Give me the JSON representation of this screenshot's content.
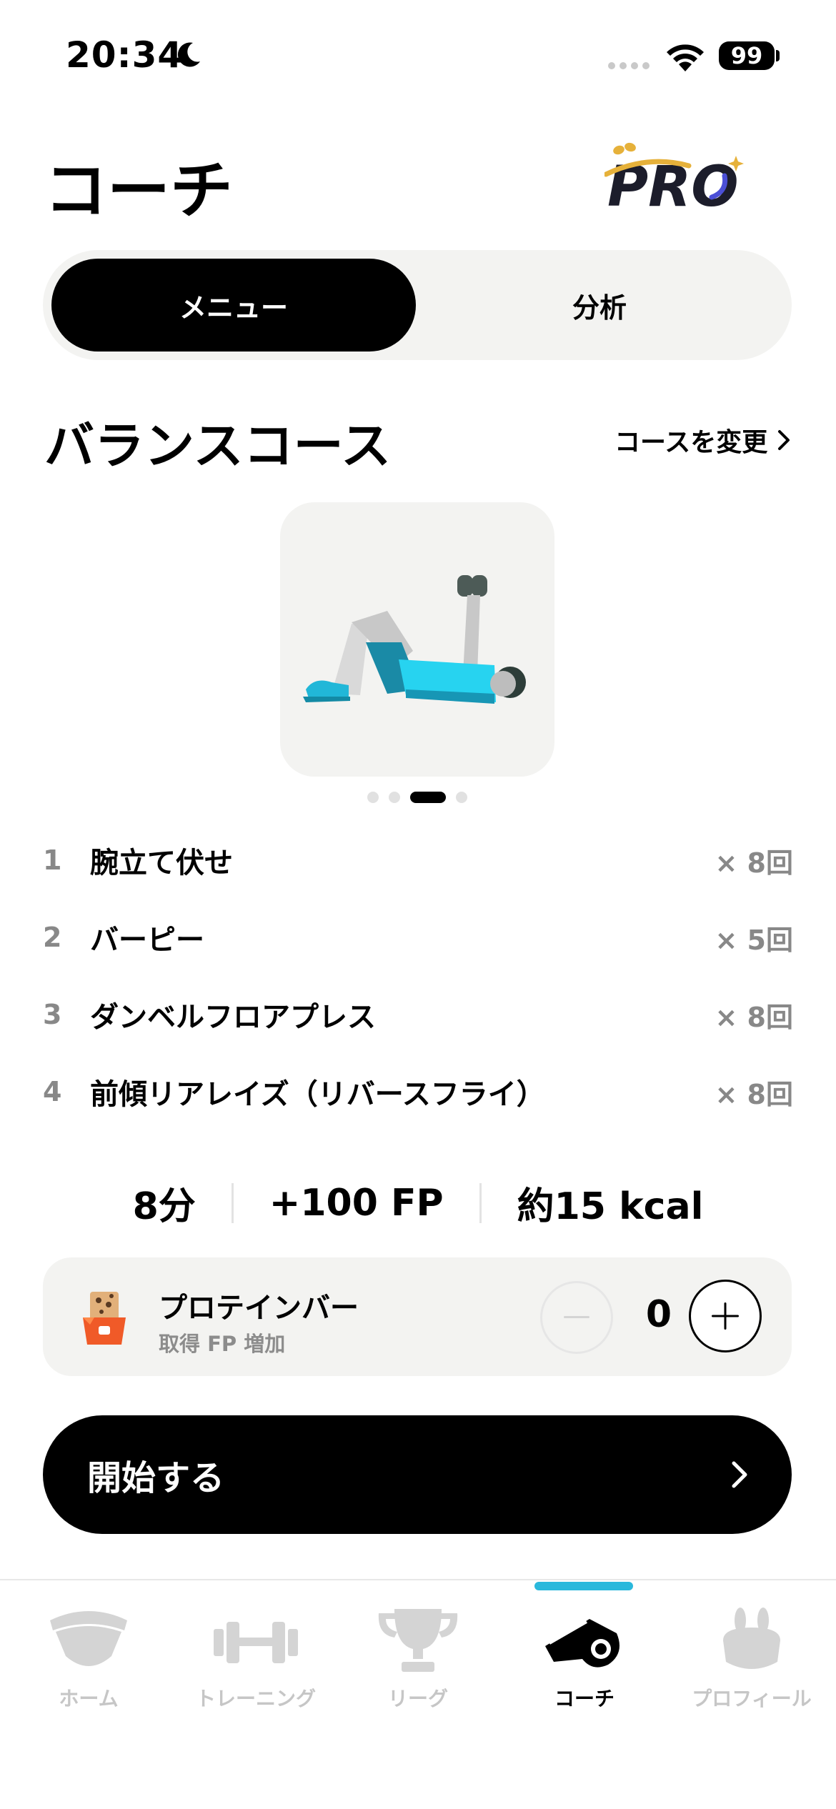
{
  "status_bar": {
    "time": "20:34",
    "battery": "99"
  },
  "header": {
    "title": "コーチ",
    "pro_badge": "PRO"
  },
  "segments": {
    "menu_label": "メニュー",
    "analysis_label": "分析",
    "active": "menu"
  },
  "course": {
    "title": "バランスコース",
    "change_label": "コースを変更",
    "carousel_total": 4,
    "carousel_active": 3
  },
  "exercises": [
    {
      "num": "1",
      "name": "腕立て伏せ",
      "reps": "× 8回"
    },
    {
      "num": "2",
      "name": "バーピー",
      "reps": "× 5回"
    },
    {
      "num": "3",
      "name": "ダンベルフロアプレス",
      "reps": "× 8回"
    },
    {
      "num": "4",
      "name": "前傾リアレイズ（リバースフライ）",
      "reps": "× 8回"
    }
  ],
  "stats": {
    "duration": "8分",
    "fp": "+100 FP",
    "calories": "約15 kcal"
  },
  "protein": {
    "name": "プロテインバー",
    "subtitle": "取得 FP 増加",
    "count": "0"
  },
  "start_button": {
    "label": "開始する"
  },
  "tabs": [
    {
      "label": "ホーム",
      "icon": "home-icon",
      "active": false
    },
    {
      "label": "トレーニング",
      "icon": "dumbbell-icon",
      "active": false
    },
    {
      "label": "リーグ",
      "icon": "trophy-icon",
      "active": false
    },
    {
      "label": "コーチ",
      "icon": "whistle-icon",
      "active": true
    },
    {
      "label": "プロフィール",
      "icon": "rabbit-icon",
      "active": false
    }
  ],
  "colors": {
    "accent_cyan": "#2ab8dc",
    "pro_gold": "#e6b13a",
    "pro_purple": "#4b4fd6"
  }
}
